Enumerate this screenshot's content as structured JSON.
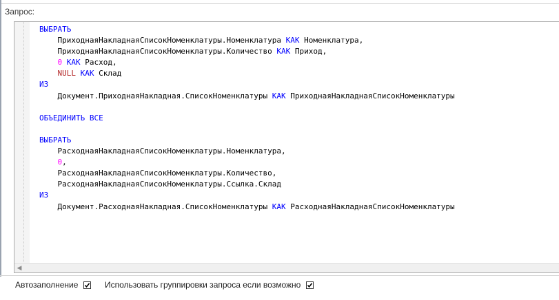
{
  "query_label": "Запрос:",
  "code_lines": [
    [
      {
        "t": "ВЫБРАТЬ",
        "c": "kw"
      }
    ],
    [
      {
        "t": "    ПриходнаяНакладнаяСписокНоменклатуры.Номенклатура "
      },
      {
        "t": "КАК",
        "c": "kw"
      },
      {
        "t": " Номенклатура,"
      }
    ],
    [
      {
        "t": "    ПриходнаяНакладнаяСписокНоменклатуры.Количество "
      },
      {
        "t": "КАК",
        "c": "kw"
      },
      {
        "t": " Приход,"
      }
    ],
    [
      {
        "t": "    "
      },
      {
        "t": "0",
        "c": "num"
      },
      {
        "t": " "
      },
      {
        "t": "КАК",
        "c": "kw"
      },
      {
        "t": " Расход,"
      }
    ],
    [
      {
        "t": "    "
      },
      {
        "t": "NULL",
        "c": "null"
      },
      {
        "t": " "
      },
      {
        "t": "КАК",
        "c": "kw"
      },
      {
        "t": " Склад"
      }
    ],
    [
      {
        "t": "ИЗ",
        "c": "kw"
      }
    ],
    [
      {
        "t": "    Документ.ПриходнаяНакладная.СписокНоменклатуры "
      },
      {
        "t": "КАК",
        "c": "kw"
      },
      {
        "t": " ПриходнаяНакладнаяСписокНоменклатуры"
      }
    ],
    [],
    [
      {
        "t": "ОБЪЕДИНИТЬ ВСЕ",
        "c": "kw"
      }
    ],
    [],
    [
      {
        "t": "ВЫБРАТЬ",
        "c": "kw"
      }
    ],
    [
      {
        "t": "    РасходнаяНакладнаяСписокНоменклатуры.Номенклатура,"
      }
    ],
    [
      {
        "t": "    "
      },
      {
        "t": "0",
        "c": "num"
      },
      {
        "t": ","
      }
    ],
    [
      {
        "t": "    РасходнаяНакладнаяСписокНоменклатуры.Количество,"
      }
    ],
    [
      {
        "t": "    РасходнаяНакладнаяСписокНоменклатуры.Ссылка.Склад"
      }
    ],
    [
      {
        "t": "ИЗ",
        "c": "kw"
      }
    ],
    [
      {
        "t": "    Документ.РасходнаяНакладная.СписокНоменклатуры "
      },
      {
        "t": "КАК",
        "c": "kw"
      },
      {
        "t": " РасходнаяНакладнаяСписокНоменклатуры"
      }
    ]
  ],
  "options": {
    "autofill_label": "Автозаполнение",
    "autofill_checked": true,
    "grouping_label": "Использовать группировки запроса если возможно",
    "grouping_checked": true
  },
  "colors": {
    "keyword": "#0000ff",
    "number": "#ff00ff",
    "null": "#b22222"
  }
}
